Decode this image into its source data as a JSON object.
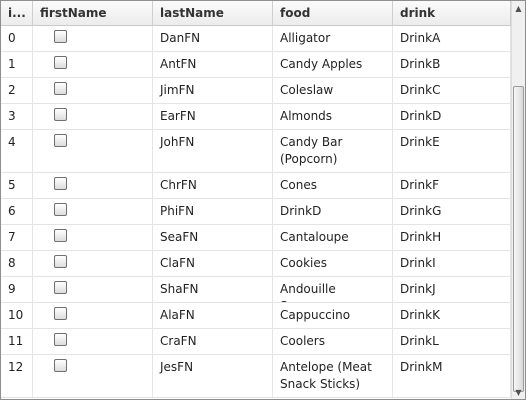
{
  "columns": [
    "id",
    "firstName",
    "lastName",
    "food",
    "drink"
  ],
  "columns_display": [
    "i...",
    "firstName",
    "lastName",
    "food",
    "drink"
  ],
  "rows": [
    {
      "id": "0",
      "last": "DanFN",
      "food": "Alligator",
      "drink": "DrinkA",
      "checked": false
    },
    {
      "id": "1",
      "last": "AntFN",
      "food": "Candy Apples",
      "drink": "DrinkB",
      "checked": false
    },
    {
      "id": "2",
      "last": "JimFN",
      "food": "Coleslaw",
      "drink": "DrinkC",
      "checked": false
    },
    {
      "id": "3",
      "last": "EarFN",
      "food": "Almonds",
      "drink": "DrinkD",
      "checked": false
    },
    {
      "id": "4",
      "last": "JohFN",
      "food": "Candy Bar (Popcorn)",
      "drink": "DrinkE",
      "checked": false
    },
    {
      "id": "5",
      "last": "ChrFN",
      "food": "Cones",
      "drink": "DrinkF",
      "checked": false
    },
    {
      "id": "6",
      "last": "PhiFN",
      "food": "DrinkD",
      "drink": "DrinkG",
      "checked": false
    },
    {
      "id": "7",
      "last": "SeaFN",
      "food": "Cantaloupe",
      "drink": "DrinkH",
      "checked": false
    },
    {
      "id": "8",
      "last": "ClaFN",
      "food": "Cookies",
      "drink": "DrinkI",
      "checked": false
    },
    {
      "id": "9",
      "last": "ShaFN",
      "food": "Andouille Sausage",
      "drink": "DrinkJ",
      "checked": false
    },
    {
      "id": "10",
      "last": "AlaFN",
      "food": "Cappuccino",
      "drink": "DrinkK",
      "checked": false
    },
    {
      "id": "11",
      "last": "CraFN",
      "food": "Coolers",
      "drink": "DrinkL",
      "checked": false
    },
    {
      "id": "12",
      "last": "JesFN",
      "food": "Antelope (Meat Snack Sticks)",
      "drink": "DrinkM",
      "checked": false
    }
  ],
  "scrollbar": {
    "up_icon": "triangle-up",
    "down_icon": "triangle-down"
  }
}
